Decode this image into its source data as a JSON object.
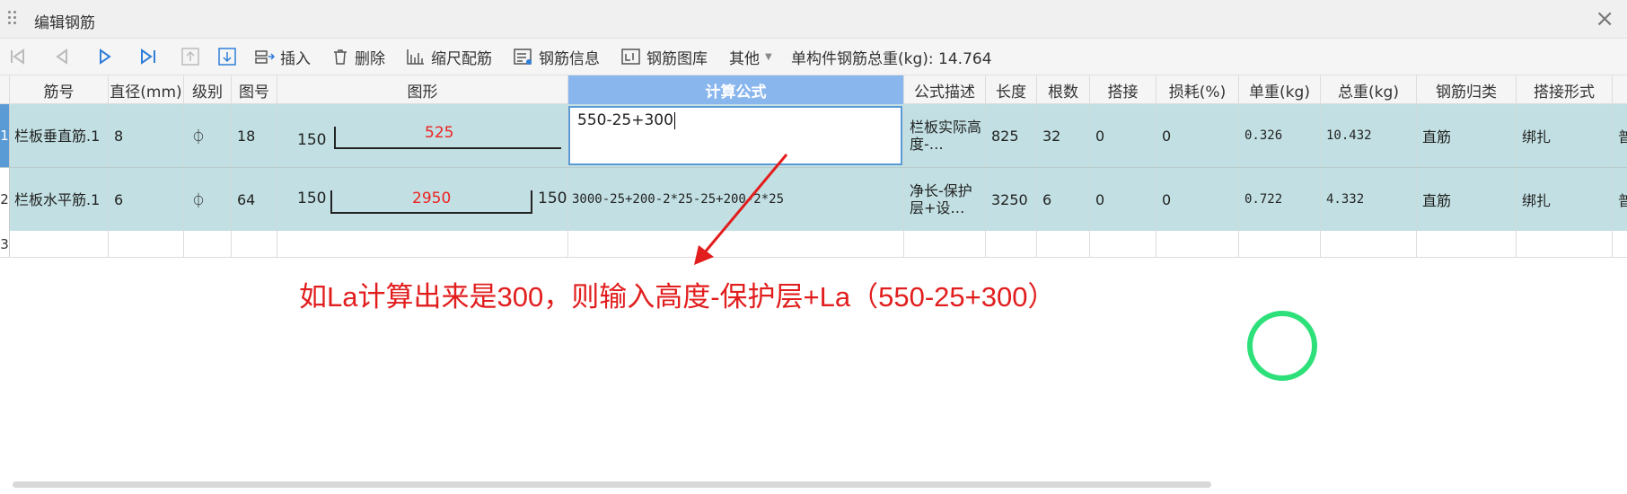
{
  "window": {
    "title": "编辑钢筋"
  },
  "toolbar": {
    "insert": "插入",
    "delete": "删除",
    "scale": "缩尺配筋",
    "info": "钢筋信息",
    "library": "钢筋图库",
    "other": "其他",
    "weight_label": "单构件钢筋总重(kg): 14.764"
  },
  "columns": [
    "筋号",
    "直径(mm)",
    "级别",
    "图号",
    "图形",
    "计算公式",
    "公式描述",
    "长度",
    "根数",
    "搭接",
    "损耗(%)",
    "单重(kg)",
    "总重(kg)",
    "钢筋归类",
    "搭接形式"
  ],
  "rows": [
    {
      "num": "1",
      "name": "栏板垂直筋.1",
      "diameter": "8",
      "grade": "⏀",
      "fig": "18",
      "shape_left": "150",
      "shape_mid": "525",
      "shape_right": "",
      "formula": "550-25+300",
      "desc": "栏板实际高度-…",
      "length": "825",
      "count": "32",
      "lap": "0",
      "loss": "0",
      "unit_wt": "0.326",
      "total_wt": "10.432",
      "category": "直筋",
      "lap_type": "绑扎",
      "extra": "普"
    },
    {
      "num": "2",
      "name": "栏板水平筋.1",
      "diameter": "6",
      "grade": "⏀",
      "fig": "64",
      "shape_left": "150",
      "shape_mid": "2950",
      "shape_right": "150",
      "formula": "3000-25+200-2*25-25+200-2*25",
      "desc": "净长-保护层+设…",
      "length": "3250",
      "count": "6",
      "lap": "0",
      "loss": "0",
      "unit_wt": "0.722",
      "total_wt": "4.332",
      "category": "直筋",
      "lap_type": "绑扎",
      "extra": "普"
    },
    {
      "num": "3"
    }
  ],
  "annotation": "如La计算出来是300，则输入高度-保护层+La（550-25+300）",
  "colors": {
    "row_bg": "#c2e0e3",
    "header_selected": "#8ab6ee",
    "annotation": "#e21d1d",
    "circle": "#2ee07a"
  }
}
